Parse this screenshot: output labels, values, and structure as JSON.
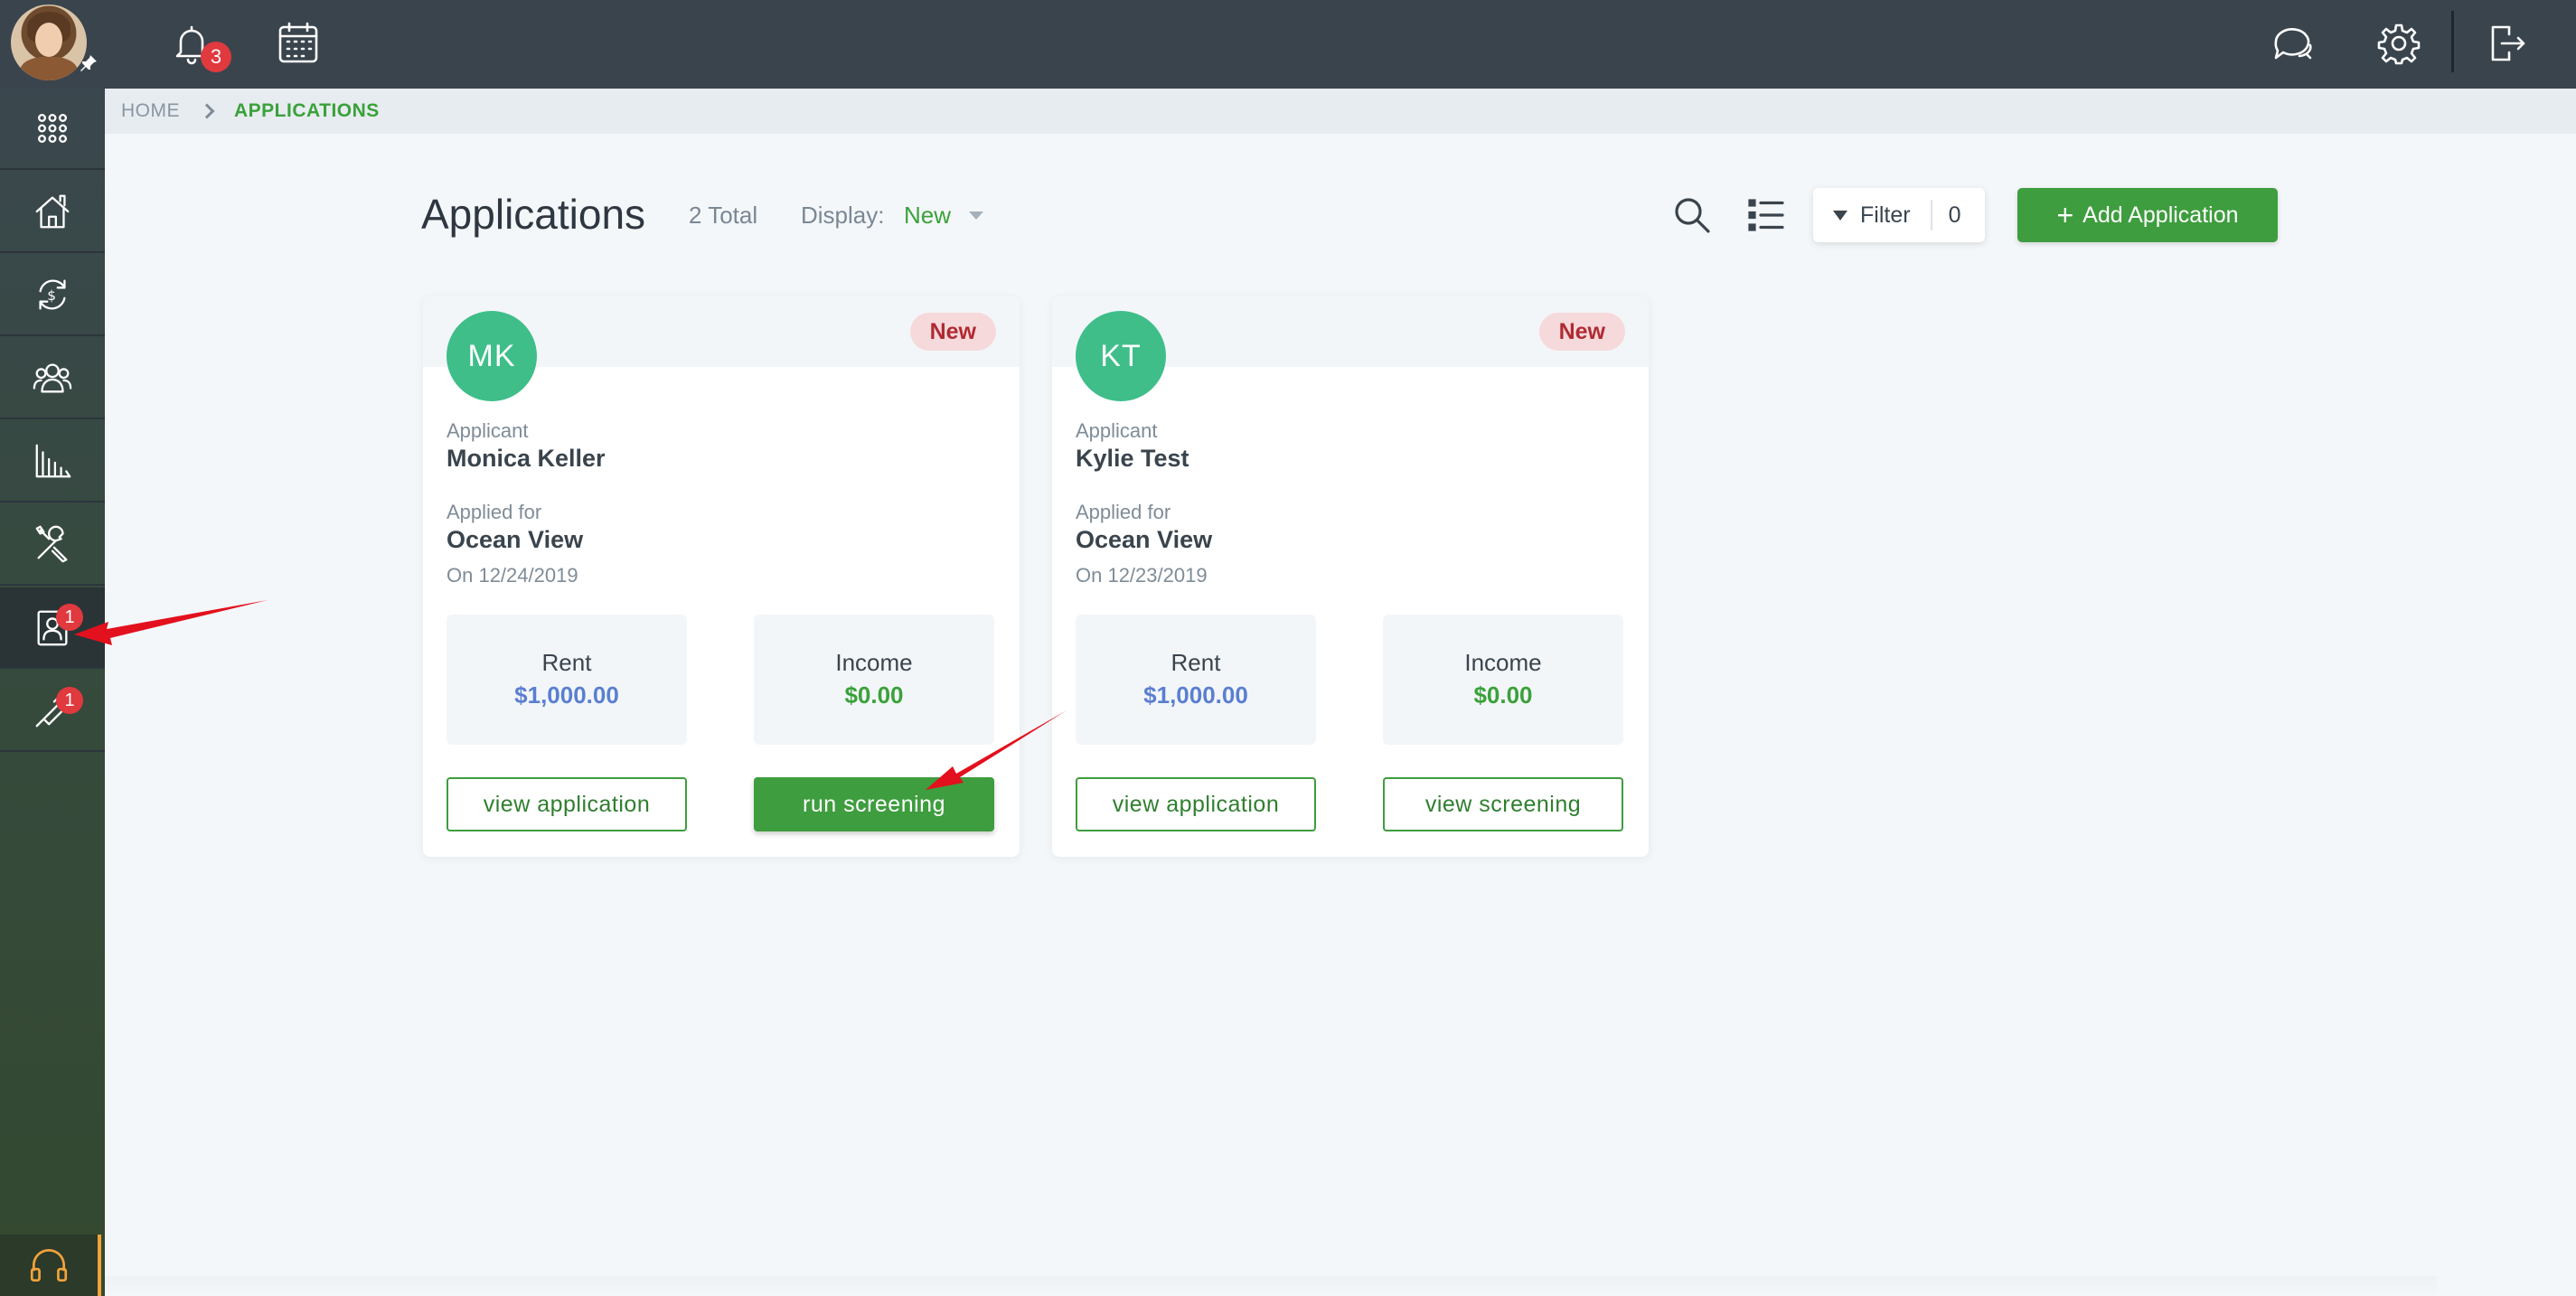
{
  "topbar": {
    "notification_count": "3",
    "icons": [
      "bell-icon",
      "calendar-icon",
      "chat-icon",
      "gear-icon",
      "logout-icon"
    ]
  },
  "sidebar": {
    "items": [
      {
        "name": "apps-grid-icon"
      },
      {
        "name": "properties-icon"
      },
      {
        "name": "payments-icon"
      },
      {
        "name": "people-icon"
      },
      {
        "name": "reports-icon"
      },
      {
        "name": "maintenance-icon"
      },
      {
        "name": "applications-icon",
        "badge": "1",
        "active": true
      },
      {
        "name": "leasing-icon",
        "badge": "1"
      }
    ],
    "help_icon": "headset-icon"
  },
  "breadcrumb": {
    "home": "HOME",
    "current": "APPLICATIONS"
  },
  "header": {
    "title": "Applications",
    "total": "2 Total",
    "display_label": "Display:",
    "display_value": "New",
    "filter_label": "Filter",
    "filter_count": "0",
    "add_label": "Add Application"
  },
  "applications": [
    {
      "initials": "MK",
      "status": "New",
      "applicant_label": "Applicant",
      "applicant": "Monica Keller",
      "applied_for_label": "Applied for",
      "property": "Ocean View",
      "date": "On 12/24/2019",
      "rent_label": "Rent",
      "rent": "$1,000.00",
      "income_label": "Income",
      "income": "$0.00",
      "left_button": "view application",
      "right_button": "run screening"
    },
    {
      "initials": "KT",
      "status": "New",
      "applicant_label": "Applicant",
      "applicant": "Kylie Test",
      "applied_for_label": "Applied for",
      "property": "Ocean View",
      "date": "On 12/23/2019",
      "rent_label": "Rent",
      "rent": "$1,000.00",
      "income_label": "Income",
      "income": "$0.00",
      "left_button": "view application",
      "right_button": "view screening"
    }
  ],
  "colors": {
    "accent_green": "#3e9d3e",
    "badge_red": "#e0393e",
    "avatar_green": "#3fbe8a",
    "annotation_red": "#e3101d"
  }
}
